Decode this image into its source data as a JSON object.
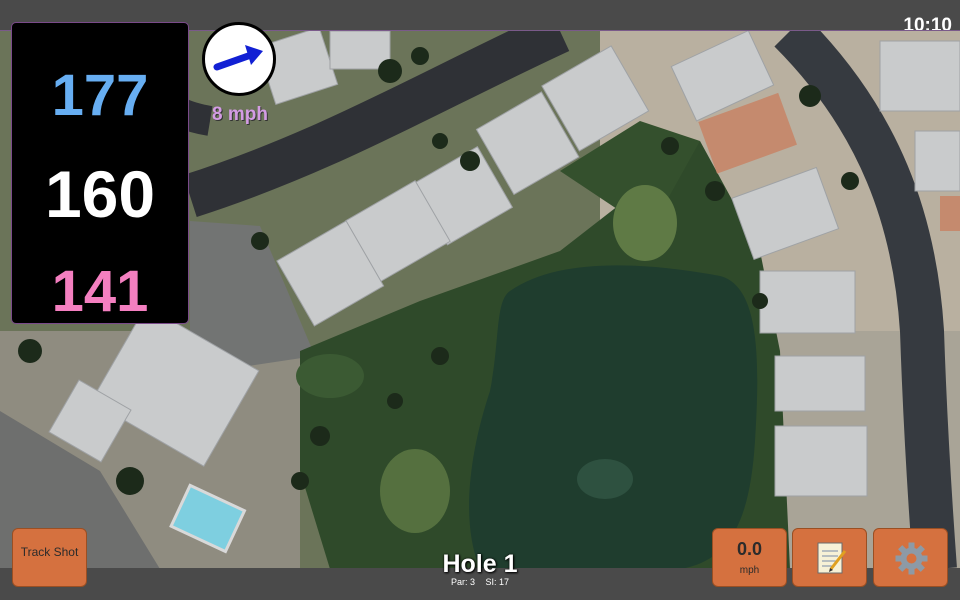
{
  "status": {
    "time": "10:10"
  },
  "distances": {
    "back": "177",
    "middle": "160",
    "front": "141",
    "colors": {
      "back": "#67aef2",
      "middle": "#ffffff",
      "front": "#f47fc0"
    }
  },
  "wind": {
    "speed": "8 mph",
    "arrow_icon": "arrow-right-icon",
    "color": "#d49ce4"
  },
  "hole": {
    "title": "Hole 1",
    "par": "Par: 3",
    "stroke_index": "SI: 17"
  },
  "buttons": {
    "track_shot": "Track Shot",
    "speed_value": "0.0",
    "speed_unit": "mph",
    "notes_icon": "notepad-icon",
    "settings_icon": "gear-icon",
    "color": "#d5713f"
  }
}
